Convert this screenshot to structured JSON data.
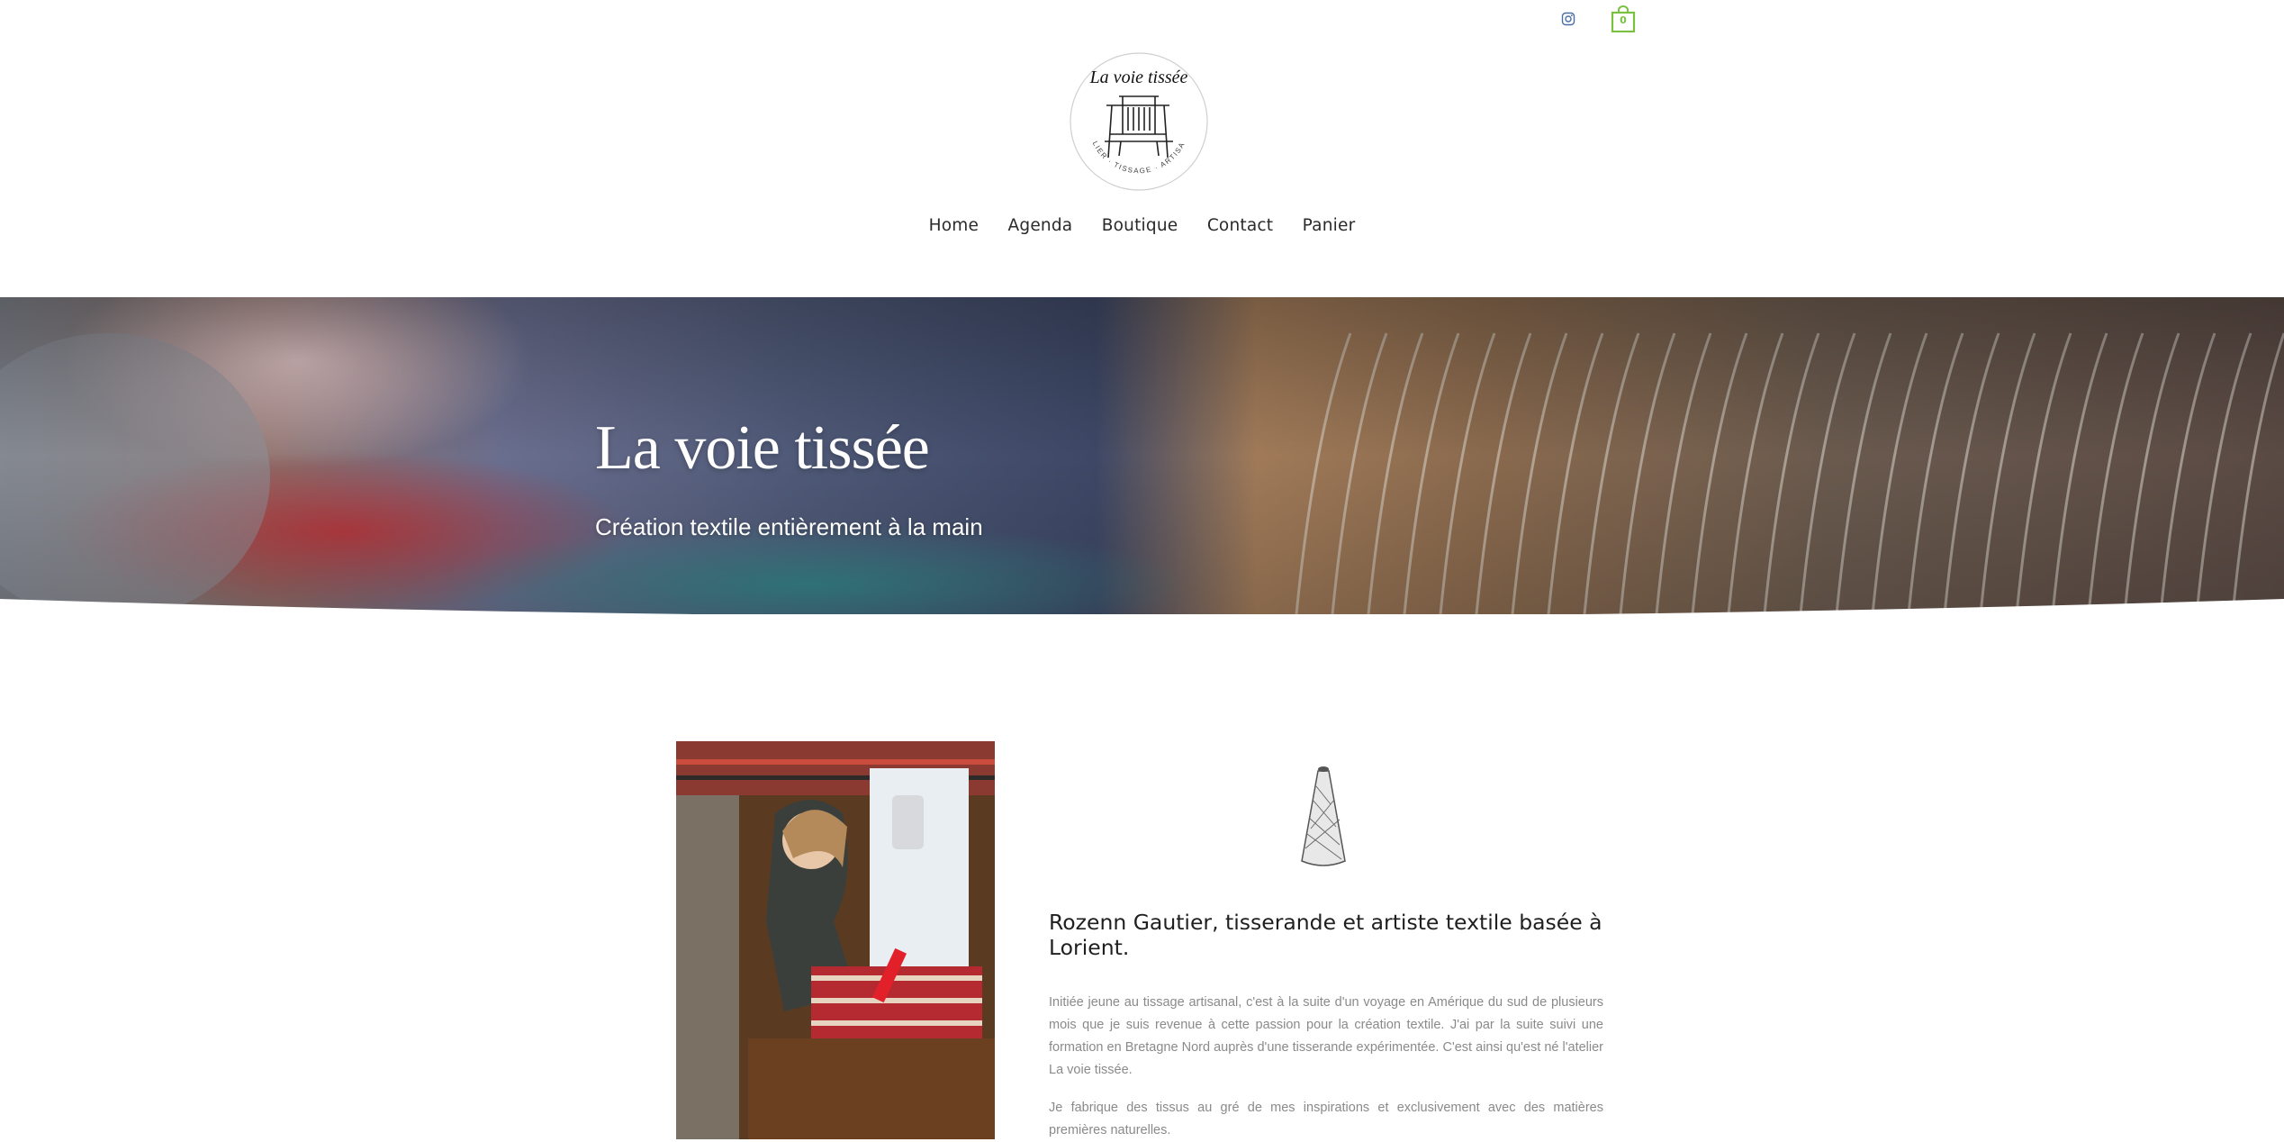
{
  "header": {
    "social_icon": "instagram-icon",
    "cart_icon": "shopping-bag-icon",
    "cart_count": "0",
    "accent_color": "#7ac142",
    "logo": {
      "title": "La voie tissée",
      "tagline": "ATELIER · TISSAGE · ARTISANAL"
    }
  },
  "nav": {
    "items": [
      "Home",
      "Agenda",
      "Boutique",
      "Contact",
      "Panier"
    ]
  },
  "hero": {
    "title": "La voie tissée",
    "subtitle": "Création textile entièrement à la main"
  },
  "about": {
    "heading": "Rozenn Gautier, tisserande et artiste textile basée à Lorient.",
    "paragraphs": [
      "Initiée jeune au tissage artisanal, c'est à la suite d'un voyage en Amérique du sud de plusieurs mois que je suis revenue à cette passion pour la création textile. J'ai par la suite suivi une formation en Bretagne Nord auprès d'une tisserande expérimentée. C'est ainsi qu'est né l'atelier La voie tissée.",
      "Je fabrique des tissus au gré de mes inspirations et exclusivement avec des matières premières naturelles."
    ]
  }
}
